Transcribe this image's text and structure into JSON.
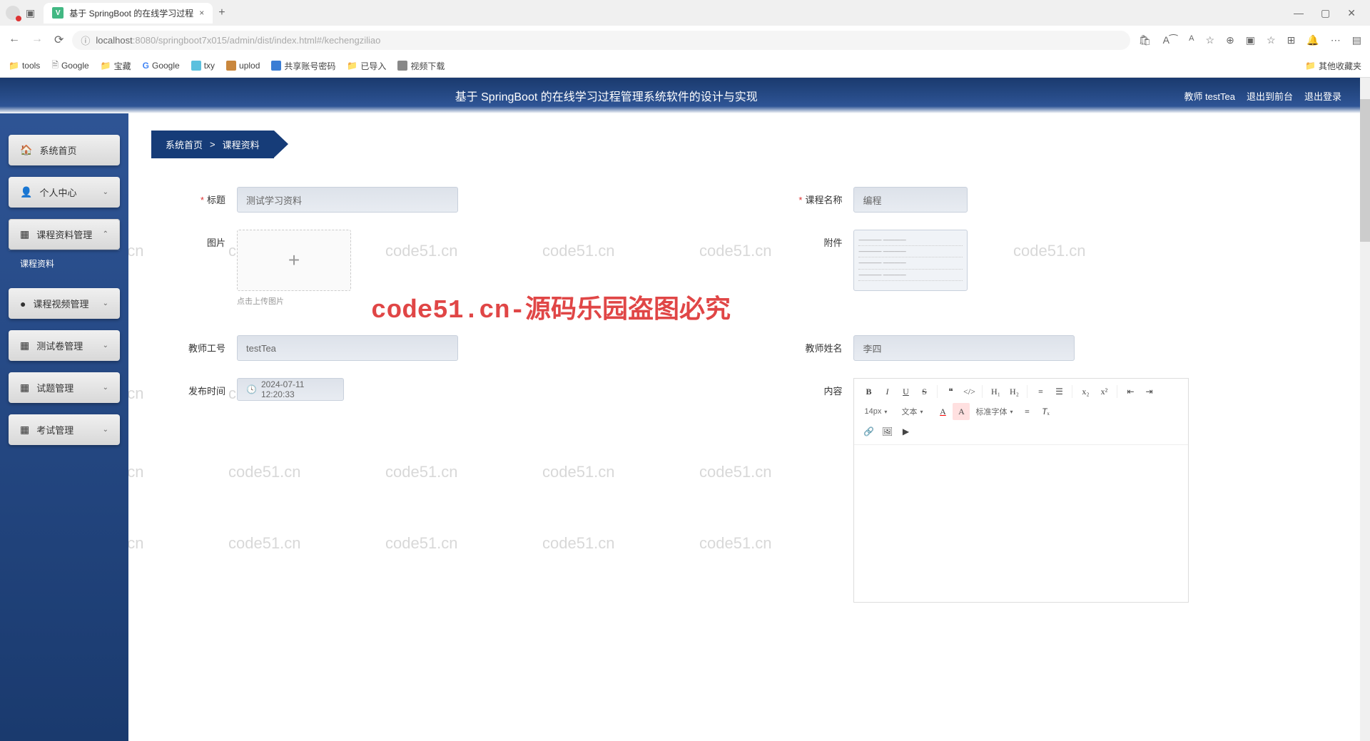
{
  "browser": {
    "tab_title": "基于 SpringBoot 的在线学习过程",
    "url_prefix": "localhost",
    "url_path": ":8080/springboot7x015/admin/dist/index.html#/kechengziliao",
    "bookmarks": [
      {
        "icon": "folder",
        "label": "tools"
      },
      {
        "icon": "file",
        "label": "Google"
      },
      {
        "icon": "folder",
        "label": "宝藏"
      },
      {
        "icon": "google",
        "label": "Google"
      },
      {
        "icon": "blue",
        "label": "txy"
      },
      {
        "icon": "brown",
        "label": "uplod"
      },
      {
        "icon": "blue2",
        "label": "共享账号密码"
      },
      {
        "icon": "folder",
        "label": "已导入"
      },
      {
        "icon": "gray",
        "label": "视频下载"
      }
    ],
    "bookmarks_right": "其他收藏夹"
  },
  "header": {
    "title": "基于 SpringBoot 的在线学习过程管理系统软件的设计与实现",
    "user_label": "教师 testTea",
    "exit_front": "退出到前台",
    "logout": "退出登录"
  },
  "sidebar": {
    "items": [
      {
        "icon": "🏠",
        "label": "系统首页",
        "chevron": ""
      },
      {
        "icon": "👤",
        "label": "个人中心",
        "chevron": "⌄"
      },
      {
        "icon": "▦",
        "label": "课程资料管理",
        "chevron": "⌃",
        "expanded": true,
        "sub": "课程资料"
      },
      {
        "icon": "●",
        "label": "课程视频管理",
        "chevron": "⌄"
      },
      {
        "icon": "▦",
        "label": "测试卷管理",
        "chevron": "⌄"
      },
      {
        "icon": "▦",
        "label": "试题管理",
        "chevron": "⌄"
      },
      {
        "icon": "▦",
        "label": "考试管理",
        "chevron": "⌄"
      }
    ]
  },
  "breadcrumb": {
    "home": "系统首页",
    "current": "课程资料"
  },
  "form": {
    "title_label": "标题",
    "title_value": "测试学习资料",
    "course_label": "课程名称",
    "course_value": "编程",
    "image_label": "图片",
    "image_hint": "点击上传图片",
    "attachment_label": "附件",
    "teacher_id_label": "教师工号",
    "teacher_id_value": "testTea",
    "teacher_name_label": "教师姓名",
    "teacher_name_value": "李四",
    "publish_label": "发布时间",
    "publish_value": "2024-07-11 12:20:33",
    "content_label": "内容"
  },
  "editor": {
    "font_size": "14px",
    "font_style": "文本",
    "font_family": "标准字体"
  },
  "watermark_text": "code51.cn",
  "watermark_big": "code51.cn-源码乐园盗图必究"
}
